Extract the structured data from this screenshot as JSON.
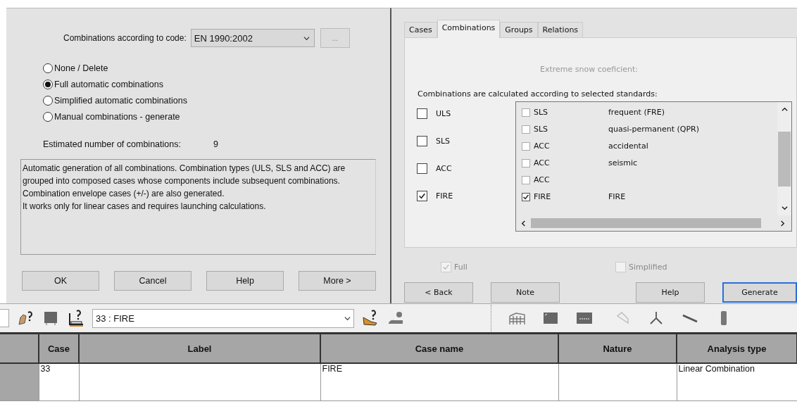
{
  "left_dialog": {
    "code_label": "Combinations according to code:",
    "code_value": "EN 1990:2002",
    "browse_button": "...",
    "options": [
      {
        "label": "None / Delete",
        "selected": false
      },
      {
        "label": "Full automatic combinations",
        "selected": true
      },
      {
        "label": "Simplified automatic combinations",
        "selected": false
      },
      {
        "label": "Manual combinations - generate",
        "selected": false
      }
    ],
    "estimate_label": "Estimated number of combinations:",
    "estimate_value": "9",
    "description": [
      "Automatic generation of all combinations. Combination types (ULS, SLS and ACC) are grouped into composed cases whose components include subsequent combinations. Combination envelope cases (+/-) are also generated.",
      "It works only for linear cases and requires launching calculations."
    ],
    "buttons": [
      "OK",
      "Cancel",
      "Help",
      "More >"
    ]
  },
  "right_dialog": {
    "tabs": [
      {
        "label": "Cases",
        "selected": false
      },
      {
        "label": "Combinations",
        "selected": true
      },
      {
        "label": "Groups",
        "selected": false
      },
      {
        "label": "Relations",
        "selected": false
      }
    ],
    "snow_label": "Extreme snow coeficient:",
    "standards_label": "Combinations are calculated according to selected standards:",
    "categories": [
      {
        "label": "ULS",
        "checked": false
      },
      {
        "label": "SLS",
        "checked": false
      },
      {
        "label": "ACC",
        "checked": false
      },
      {
        "label": "FIRE",
        "checked": true
      }
    ],
    "standards": [
      {
        "type": "SLS",
        "description": "frequent (FRE)",
        "checked": false
      },
      {
        "type": "SLS",
        "description": "quasi-permanent (QPR)",
        "checked": false
      },
      {
        "type": "ACC",
        "description": "accidental",
        "checked": false
      },
      {
        "type": "ACC",
        "description": "seismic",
        "checked": false
      },
      {
        "type": "ACC",
        "checked": false
      },
      {
        "type": "FIRE",
        "description": "FIRE",
        "checked": true
      }
    ],
    "options": [
      {
        "label": "Full",
        "checked": true,
        "disabled": true
      },
      {
        "label": "Simplified",
        "checked": false,
        "disabled": true
      }
    ],
    "buttons": [
      {
        "label": "< Back",
        "default": false
      },
      {
        "label": "Note",
        "default": false
      },
      {
        "label": "Help",
        "default": false
      },
      {
        "label": "Generate",
        "default": true
      }
    ]
  },
  "toolbar": {
    "case_select": "33 : FIRE"
  },
  "table": {
    "columns": [
      "Case",
      "Label",
      "Case name",
      "Nature",
      "Analysis type"
    ],
    "rows": [
      [
        "33",
        "",
        "FIRE",
        "",
        "Linear Combination"
      ]
    ]
  }
}
